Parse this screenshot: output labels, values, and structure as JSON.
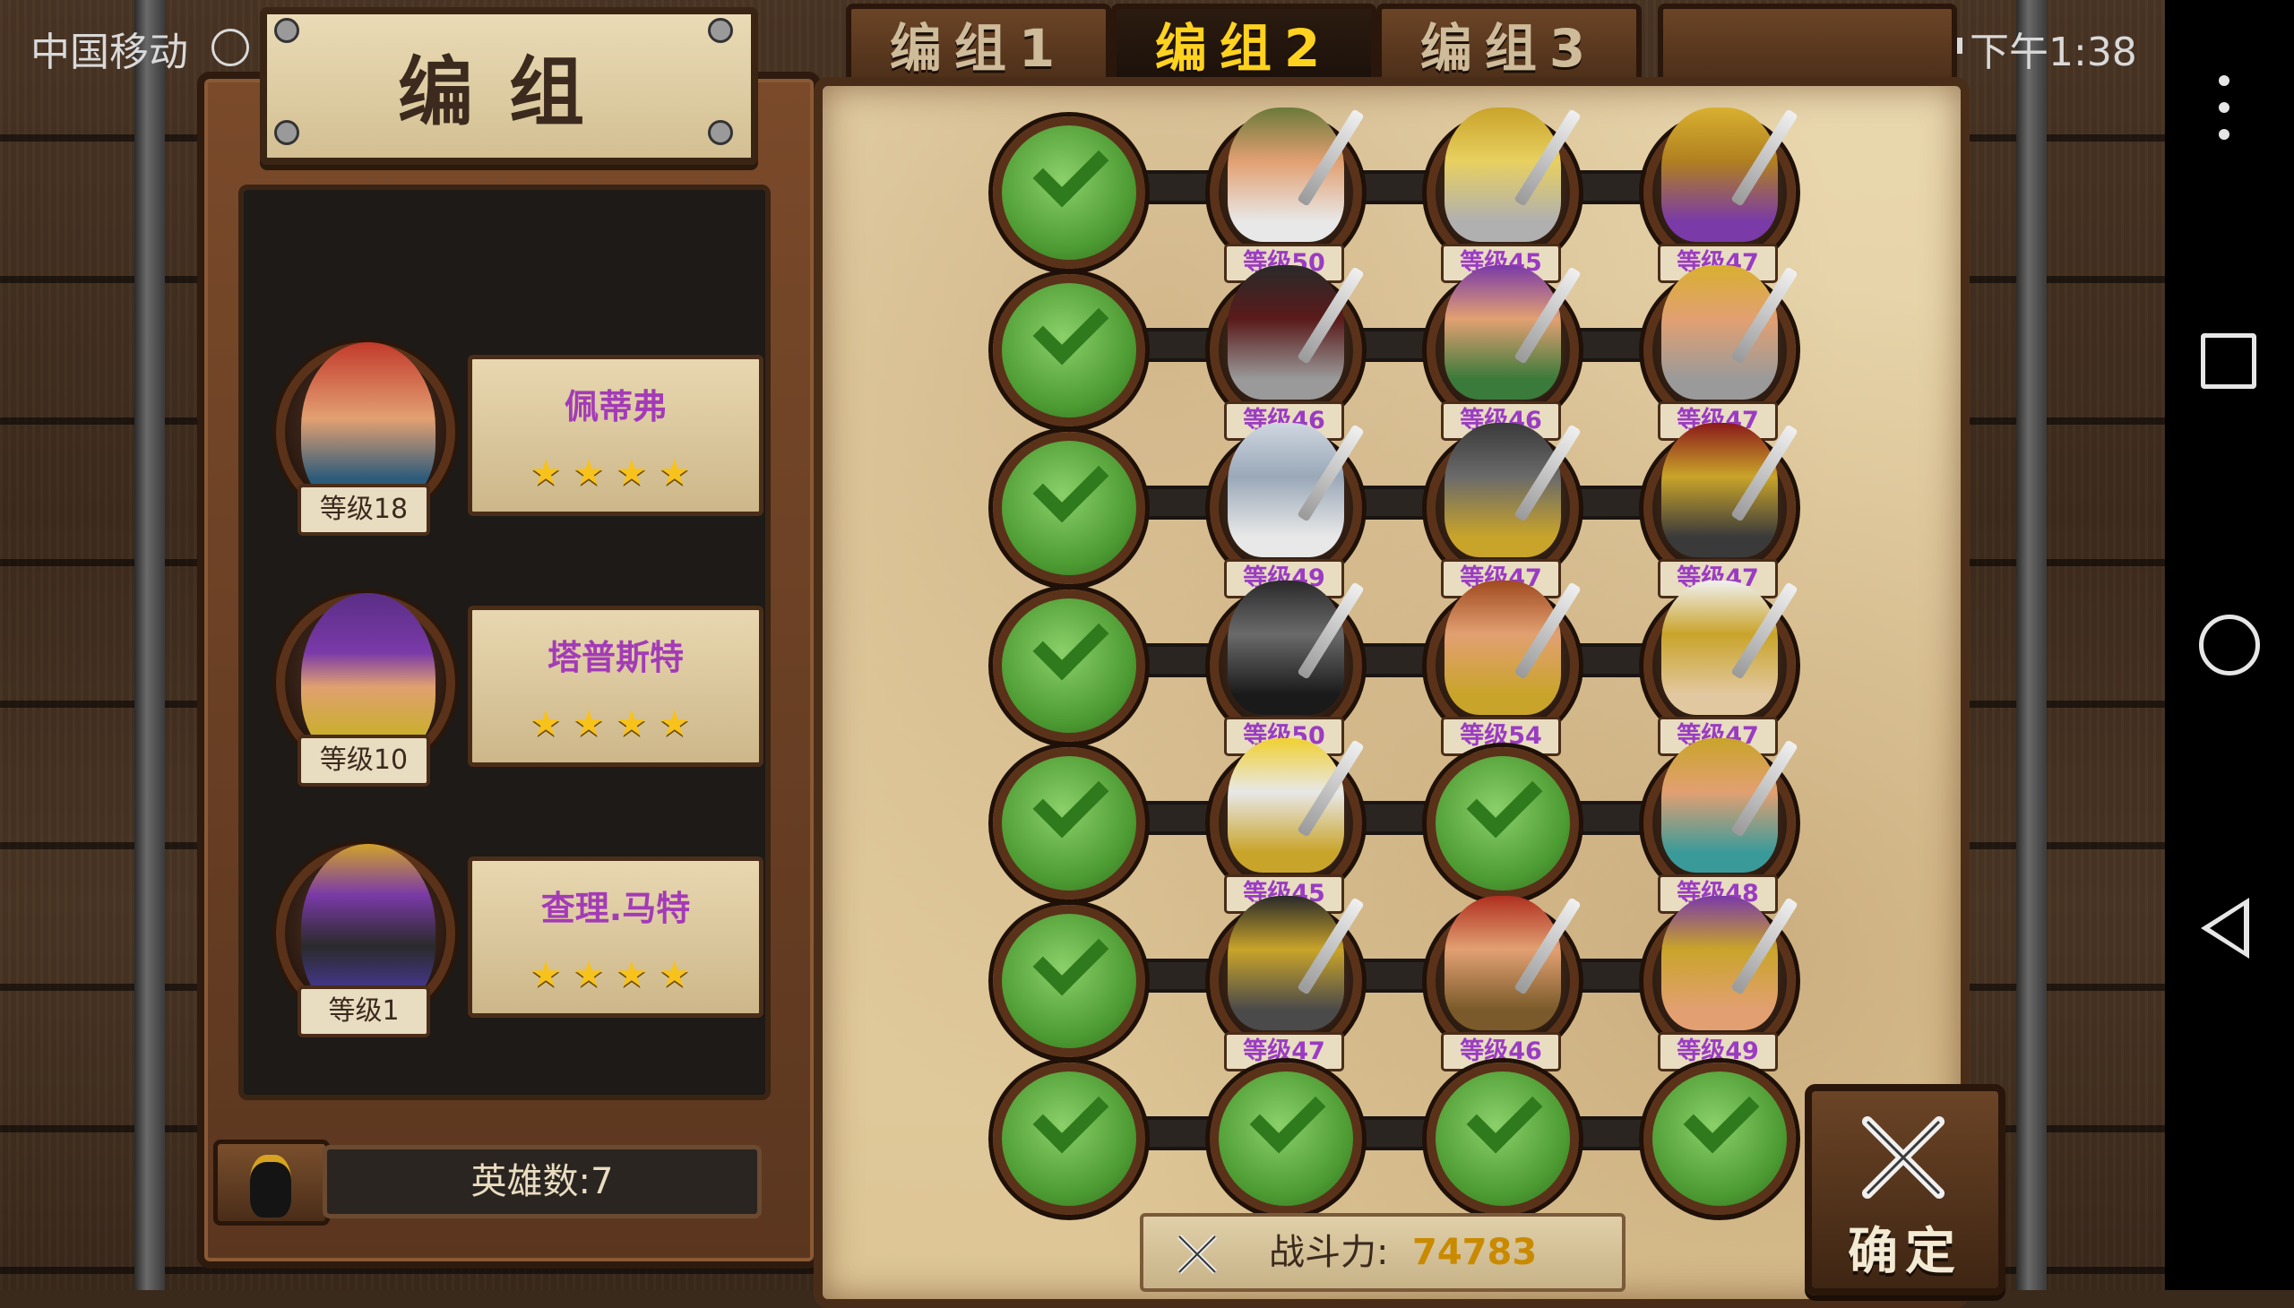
{
  "status_bar": {
    "carrier": "中国移动",
    "time": "下午1:38"
  },
  "left_panel": {
    "title": "编组",
    "heroes": [
      {
        "name": "佩蒂弗",
        "level": "等级18",
        "stars": "★★★★"
      },
      {
        "name": "塔普斯特",
        "level": "等级10",
        "stars": "★★★★"
      },
      {
        "name": "查理.马特",
        "level": "等级1",
        "stars": "★★★★"
      }
    ],
    "hero_count": "英雄数:7"
  },
  "tabs": [
    {
      "label": "编组1",
      "active": false
    },
    {
      "label": "编组2",
      "active": true
    },
    {
      "label": "编组3",
      "active": false
    }
  ],
  "formation": {
    "rows": [
      [
        "",
        "等级50",
        "等级45",
        "等级47"
      ],
      [
        "",
        "等级46",
        "等级46",
        "等级47"
      ],
      [
        "",
        "等级49",
        "等级47",
        "等级47"
      ],
      [
        "",
        "等级50",
        "等级54",
        "等级47"
      ],
      [
        "",
        "等级45",
        "",
        "等级48"
      ],
      [
        "",
        "等级47",
        "等级46",
        "等级49"
      ],
      [
        "",
        "",
        "",
        ""
      ]
    ]
  },
  "power": {
    "label": "战斗力:",
    "value": "74783"
  },
  "confirm_label": "确定",
  "colors": {
    "level_text": "#9a3cc2",
    "power_value": "#c98a00",
    "active_tab": "#ffd21f",
    "hero_name": "#a33bb7"
  }
}
